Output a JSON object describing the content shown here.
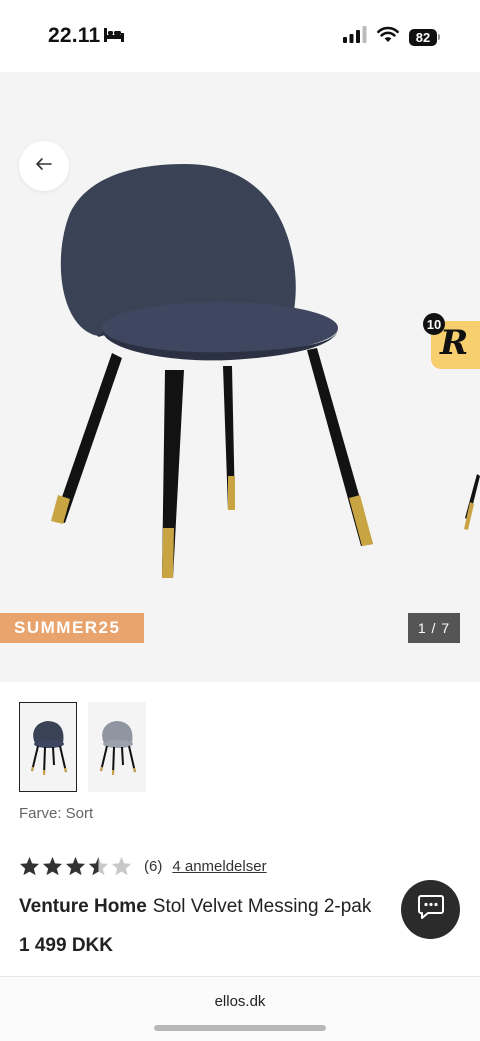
{
  "status_bar": {
    "time": "22.11",
    "battery": "82"
  },
  "gallery": {
    "campaign_tag": "SUMMER25",
    "image_counter": "1 / 7",
    "promo_badge_count": "10",
    "promo_letter": "R"
  },
  "product": {
    "color_label": "Farve: Sort",
    "rating": 3.5,
    "review_count": "(6)",
    "reviews_link": "4 anmeldelser",
    "brand": "Venture Home",
    "name": "Stol Velvet Messing 2-pak",
    "price": "1 499 DKK"
  },
  "colors": {
    "campaign": "#e9a46e",
    "chair_seat": "#3a4256",
    "chair_alt": "#8f96a1",
    "brass": "#c9a443",
    "promo": "#f7cf6e"
  },
  "browser": {
    "url": "ellos.dk"
  }
}
